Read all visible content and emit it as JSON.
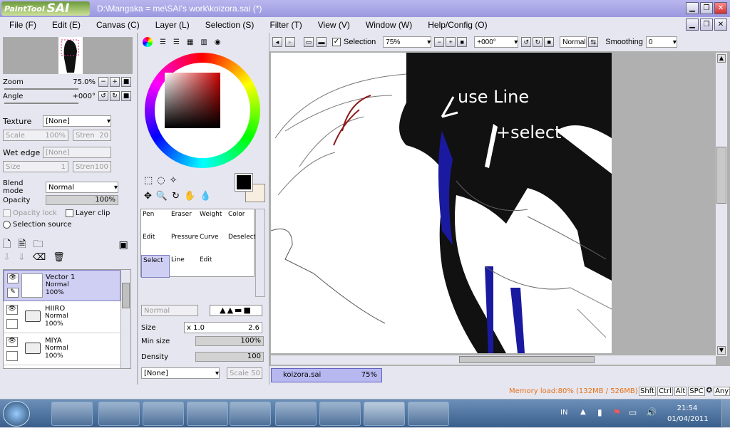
{
  "app": {
    "logo_text": "PaintTool",
    "logo_sai": "SAI",
    "title": "D:\\Mangaka = me\\SAI's work\\koizora.sai (*)"
  },
  "menu": [
    "File (F)",
    "Edit (E)",
    "Canvas (C)",
    "Layer (L)",
    "Selection (S)",
    "Filter (T)",
    "View (V)",
    "Window (W)",
    "Help/Config (O)"
  ],
  "navigator": {
    "zoom_label": "Zoom",
    "zoom_value": "75.0%",
    "angle_label": "Angle",
    "angle_value": "+000°"
  },
  "texture": {
    "texture_label": "Texture",
    "texture_value": "[None]",
    "scale_label": "Scale",
    "scale_value": "100%",
    "strength_label": "Stren",
    "strength_value": "20",
    "wet_edge_label": "Wet edge",
    "wet_edge_value": "[None]",
    "size_label": "Size",
    "size_value": "1",
    "wet_strength_label": "Stren",
    "wet_strength_value": "100"
  },
  "blend": {
    "label": "Blend mode",
    "value": "Normal",
    "opacity_label": "Opacity",
    "opacity_value": "100%"
  },
  "checks": {
    "opacity_lock": "Opacity lock",
    "layer_clip": "Layer clip",
    "selection_source": "Selection source"
  },
  "layers": [
    {
      "name": "Vector 1",
      "mode": "Normal",
      "opacity": "100%"
    },
    {
      "name": "HIIRO",
      "mode": "Normal",
      "opacity": "100%"
    },
    {
      "name": "MIYA",
      "mode": "Normal",
      "opacity": "100%"
    }
  ],
  "tools": [
    {
      "label": "Pen"
    },
    {
      "label": "Eraser"
    },
    {
      "label": "Weight"
    },
    {
      "label": "Color"
    },
    {
      "label": "Edit"
    },
    {
      "label": "Pressure"
    },
    {
      "label": "Curve"
    },
    {
      "label": "Deselect"
    },
    {
      "label": "Select"
    },
    {
      "label": "Line"
    },
    {
      "label": "Edit"
    }
  ],
  "brush": {
    "mode_value": "Normal",
    "size_label": "Size",
    "size_multiplier": "x 1.0",
    "size_value": "2.6",
    "min_size_label": "Min size",
    "min_size_value": "100%",
    "density_label": "Density",
    "density_value": "100",
    "texture_value": "[None]",
    "scale_label": "Scale",
    "scale_value": "50"
  },
  "canvas_toolbar": {
    "selection_label": "Selection",
    "zoom_value": "75%",
    "angle_value": "+000°",
    "mode_value": "Normal",
    "smoothing_label": "Smoothing",
    "smoothing_value": "0"
  },
  "canvas": {
    "annotation_line1": "use Line",
    "annotation_line2": "+select"
  },
  "doc_tab": {
    "name": "koizora.sai",
    "zoom": "75%"
  },
  "status": {
    "memory": "Memory load:80% (132MB / 526MB)",
    "keys": [
      "Shft",
      "Ctrl",
      "Alt",
      "SPC"
    ],
    "any_label": "Any"
  },
  "taskbar": {
    "lang": "IN",
    "time": "21:54",
    "date": "01/04/2011"
  },
  "colors": {
    "title_bg": "#a8a6ea",
    "panel_bg": "#e6e6f0",
    "selected": "#cfcff4",
    "memory_text": "#e87010",
    "foreground": "#000000",
    "background": "#f7eedf"
  }
}
